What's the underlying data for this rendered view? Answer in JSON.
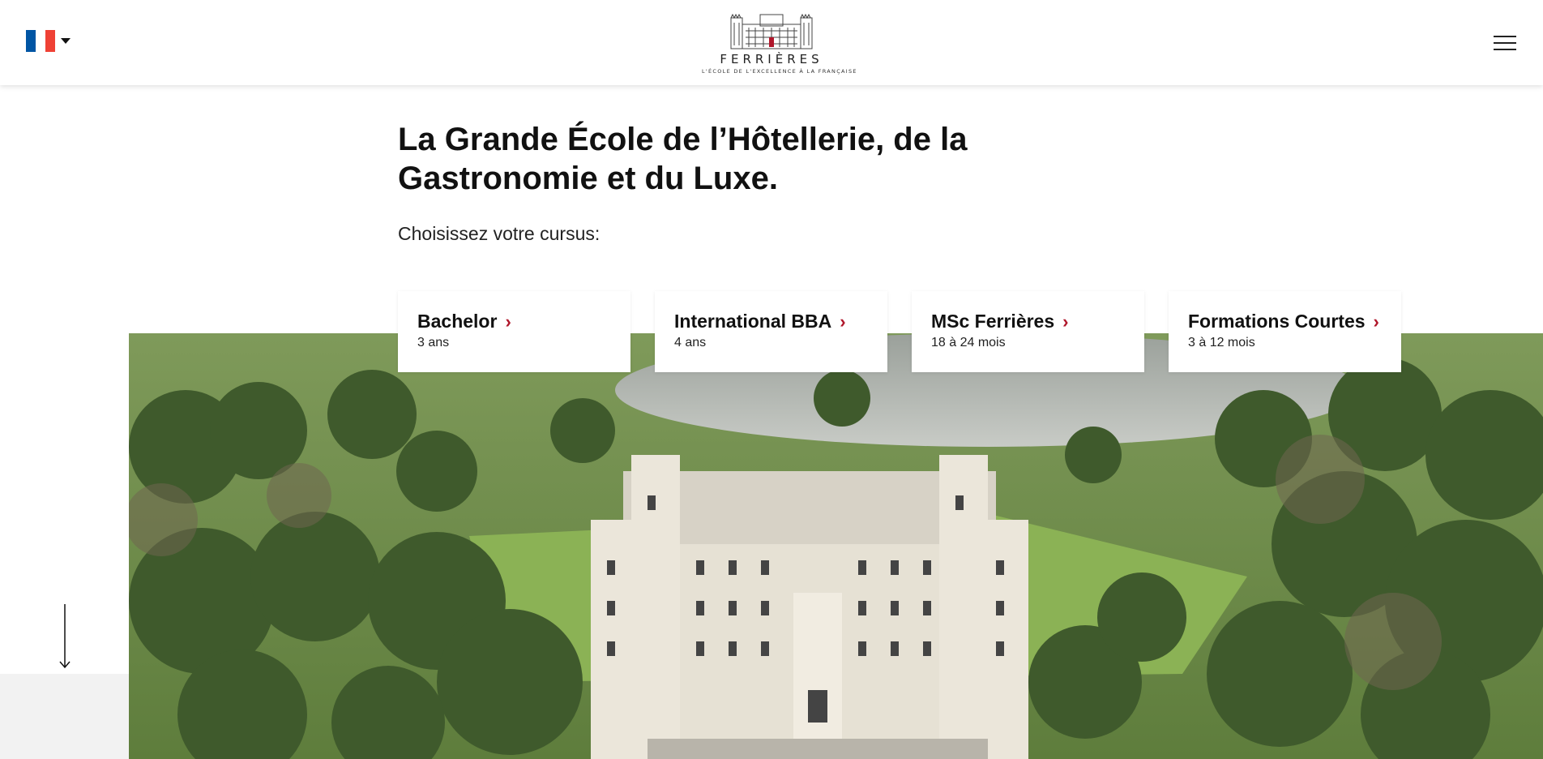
{
  "header": {
    "language": {
      "code": "fr",
      "flag_colors": [
        "#0055a4",
        "#ffffff",
        "#ef4135"
      ]
    },
    "logo": {
      "name": "FERRIÈRES",
      "tagline": "L'ÉCOLE DE L'EXCELLENCE À LA FRANÇAISE"
    },
    "menu_icon": "hamburger-icon"
  },
  "hero": {
    "title": "La Grande École de l’Hôtellerie, de la Gastronomie et du Luxe.",
    "subtitle": "Choisissez votre cursus:"
  },
  "programs": [
    {
      "title": "Bachelor",
      "duration": "3 ans",
      "arrow": "›"
    },
    {
      "title": "International BBA",
      "duration": "4 ans",
      "arrow": "›"
    },
    {
      "title": "MSc Ferrières",
      "duration": "18 à 24 mois",
      "arrow": "›"
    },
    {
      "title": "Formations Courtes",
      "duration": "3 à 12 mois",
      "arrow": "›"
    }
  ],
  "colors": {
    "accent": "#b0172b",
    "text": "#111111",
    "panel": "#f2f2f2"
  },
  "photo": {
    "subject": "chateau-aerial-photo"
  },
  "scroll_icon": "arrow-down-icon"
}
